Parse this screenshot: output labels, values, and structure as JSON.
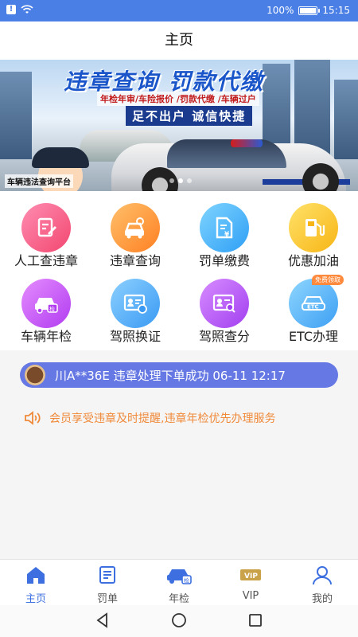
{
  "status_bar": {
    "battery": "100%",
    "time": "15:15",
    "battery_level": 1.0
  },
  "header": {
    "title": "主页"
  },
  "banner": {
    "title": "违章查询 罚款代缴",
    "subtitle": "年检年审/车险报价 /罚款代缴 /车辆过户",
    "slogan": "足不出户 诚信快捷",
    "caption": "车辆违法查询平台",
    "slide_count": 3,
    "active_slide": 1
  },
  "services": [
    {
      "label": "人工查违章",
      "icon": "edit-document-icon",
      "color_from": "#ff8db2",
      "color_to": "#f2476f"
    },
    {
      "label": "违章查询",
      "icon": "car-search-icon",
      "color_from": "#ffc06a",
      "color_to": "#ff8023"
    },
    {
      "label": "罚单缴费",
      "icon": "bill-yuan-icon",
      "color_from": "#7fd4ff",
      "color_to": "#2f9ff5"
    },
    {
      "label": "优惠加油",
      "icon": "fuel-pump-icon",
      "color_from": "#ffe26a",
      "color_to": "#f7b515"
    },
    {
      "label": "车辆年检",
      "icon": "car-inspection-icon",
      "color_from": "#e58cff",
      "color_to": "#b13cf0"
    },
    {
      "label": "驾照换证",
      "icon": "license-renew-icon",
      "color_from": "#8cd0ff",
      "color_to": "#3a9af3"
    },
    {
      "label": "驾照查分",
      "icon": "license-points-icon",
      "color_from": "#d78cff",
      "color_to": "#a23ff0"
    },
    {
      "label": "ETC办理",
      "icon": "etc-car-icon",
      "color_from": "#8ed6ff",
      "color_to": "#3d9ff3",
      "badge": "免费领取"
    }
  ],
  "notice": {
    "text": "川A**36E 违章处理下单成功 06-11 12:17"
  },
  "tip": {
    "text": "会员享受违章及时提醒,违章年检优先办理服务"
  },
  "tabs": [
    {
      "label": "主页",
      "icon": "home-icon",
      "active": true
    },
    {
      "label": "罚单",
      "icon": "ticket-icon",
      "active": false
    },
    {
      "label": "年检",
      "icon": "car-check-icon",
      "active": false
    },
    {
      "label": "VIP",
      "icon": "vip-icon",
      "active": false
    },
    {
      "label": "我的",
      "icon": "user-icon",
      "active": false
    }
  ],
  "colors": {
    "accent": "#3d6fe0",
    "status_bar": "#4a7fe6",
    "notice_bg": "#6578e3",
    "tip_text": "#f08a3a"
  }
}
